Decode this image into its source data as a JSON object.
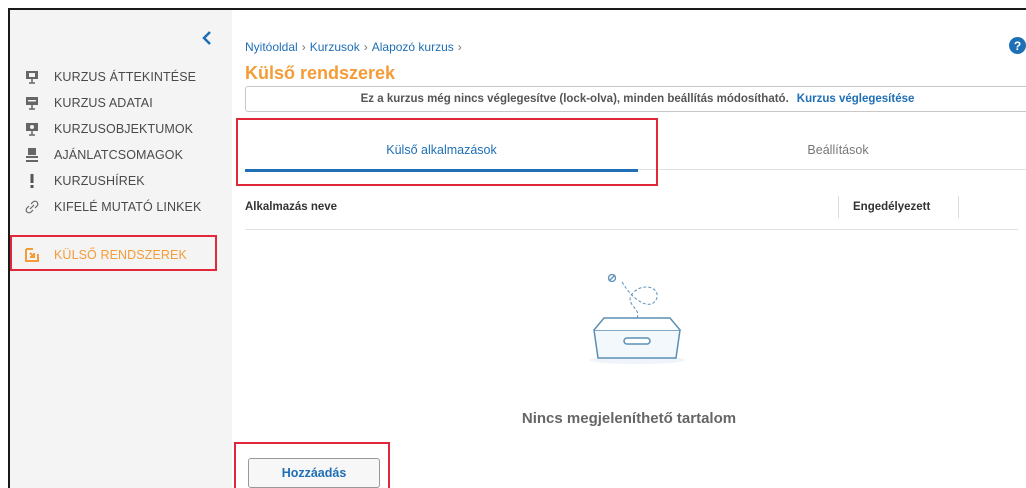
{
  "sidebar": {
    "items": [
      {
        "label": "KURZUS ÁTTEKINTÉSE",
        "icon": "presentation-board-icon",
        "active": false
      },
      {
        "label": "KURZUS ADATAI",
        "icon": "presentation-board-icon",
        "active": false
      },
      {
        "label": "KURZUSOBJEKTUMOK",
        "icon": "presentation-board-icon",
        "active": false
      },
      {
        "label": "AJÁNLATCSOMAGOK",
        "icon": "package-icon",
        "active": false
      },
      {
        "label": "KURZUSHÍREK",
        "icon": "exclamation-icon",
        "active": false
      },
      {
        "label": "KIFELÉ MUTATÓ LINKEK",
        "icon": "link-icon",
        "active": false
      },
      {
        "label": "KÜLSŐ RENDSZEREK",
        "icon": "external-system-icon",
        "active": true
      }
    ]
  },
  "breadcrumb": {
    "home": "Nyitóoldal",
    "courses": "Kurzusok",
    "current": "Alapozó kurzus",
    "sep": "›"
  },
  "help": {
    "label": "?"
  },
  "page": {
    "title": "Külső rendszerek",
    "notice_text": "Ez a kurzus még nincs véglegesítve (lock-olva), minden beállítás módosítható.",
    "notice_link": "Kurzus véglegesítése"
  },
  "tabs": [
    {
      "label": "Külső alkalmazások",
      "active": true
    },
    {
      "label": "Beállítások",
      "active": false
    }
  ],
  "table": {
    "columns": [
      "Alkalmazás neve",
      "Engedélyezett"
    ],
    "empty_text": "Nincs megjeleníthető tartalom"
  },
  "actions": {
    "add_label": "Hozzáadás"
  },
  "colors": {
    "accent": "#f39c38",
    "link": "#1e6fb5",
    "highlight": "#e0283a"
  }
}
